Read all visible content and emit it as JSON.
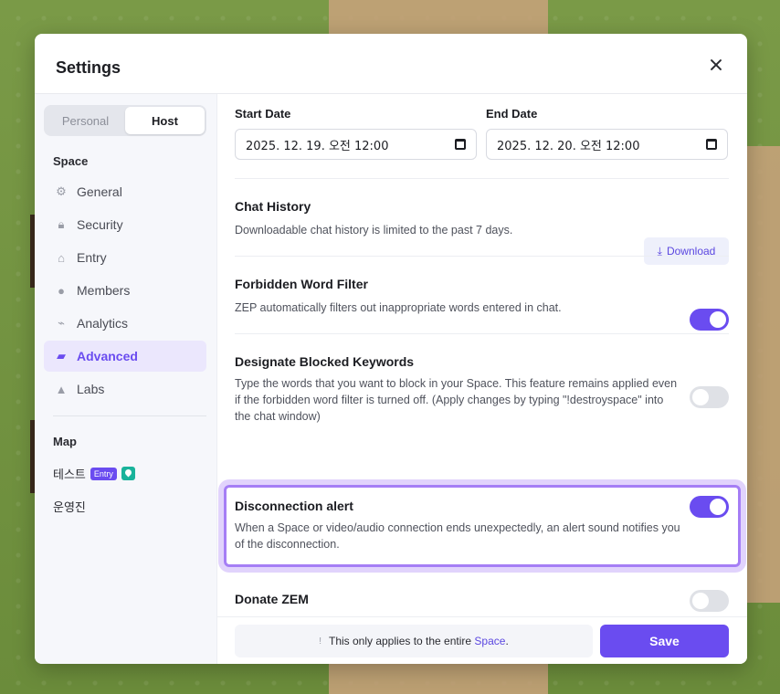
{
  "modal": {
    "title": "Settings"
  },
  "tabs": {
    "personal": "Personal",
    "host": "Host"
  },
  "sidebar": {
    "space_label": "Space",
    "items": [
      {
        "label": "General",
        "icon": "gear-icon"
      },
      {
        "label": "Security",
        "icon": "lock-icon"
      },
      {
        "label": "Entry",
        "icon": "home-icon"
      },
      {
        "label": "Members",
        "icon": "person-icon"
      },
      {
        "label": "Analytics",
        "icon": "chart-icon"
      },
      {
        "label": "Advanced",
        "icon": "folder-icon",
        "active": true
      },
      {
        "label": "Labs",
        "icon": "flask-icon"
      }
    ],
    "map_label": "Map",
    "maps": [
      {
        "name": "테스트",
        "badge": "Entry"
      },
      {
        "name": "운영진"
      }
    ]
  },
  "dates": {
    "start_label": "Start Date",
    "start_value": "2025. 12. 19. 오전 12:00",
    "end_label": "End Date",
    "end_value": "2025. 12. 20. 오전 12:00"
  },
  "settings": {
    "chat_history": {
      "title": "Chat History",
      "desc": "Downloadable chat history is limited to the past 7 days.",
      "button": "Download"
    },
    "forbidden_filter": {
      "title": "Forbidden Word Filter",
      "desc": "ZEP automatically filters out inappropriate words entered in chat.",
      "enabled": true
    },
    "blocked_keywords": {
      "title": "Designate Blocked Keywords",
      "desc": "Type the words that you want to block in your Space. This feature remains applied even if the forbidden word filter is turned off. (Apply changes by typing \"!destroyspace\" into the chat window)",
      "enabled": false
    },
    "disconnection_alert": {
      "title": "Disconnection alert",
      "desc": "When a Space or video/audio connection ends unexpectedly, an alert sound notifies you of the disconnection.",
      "enabled": true
    },
    "donate_zem": {
      "title": "Donate ZEM",
      "enabled": false
    }
  },
  "footer": {
    "notice_prefix": "This only applies to the entire",
    "notice_link": "Space",
    "notice_suffix": ".",
    "save": "Save"
  },
  "colors": {
    "accent": "#6a4cf0",
    "highlight": "#a57ef5"
  }
}
